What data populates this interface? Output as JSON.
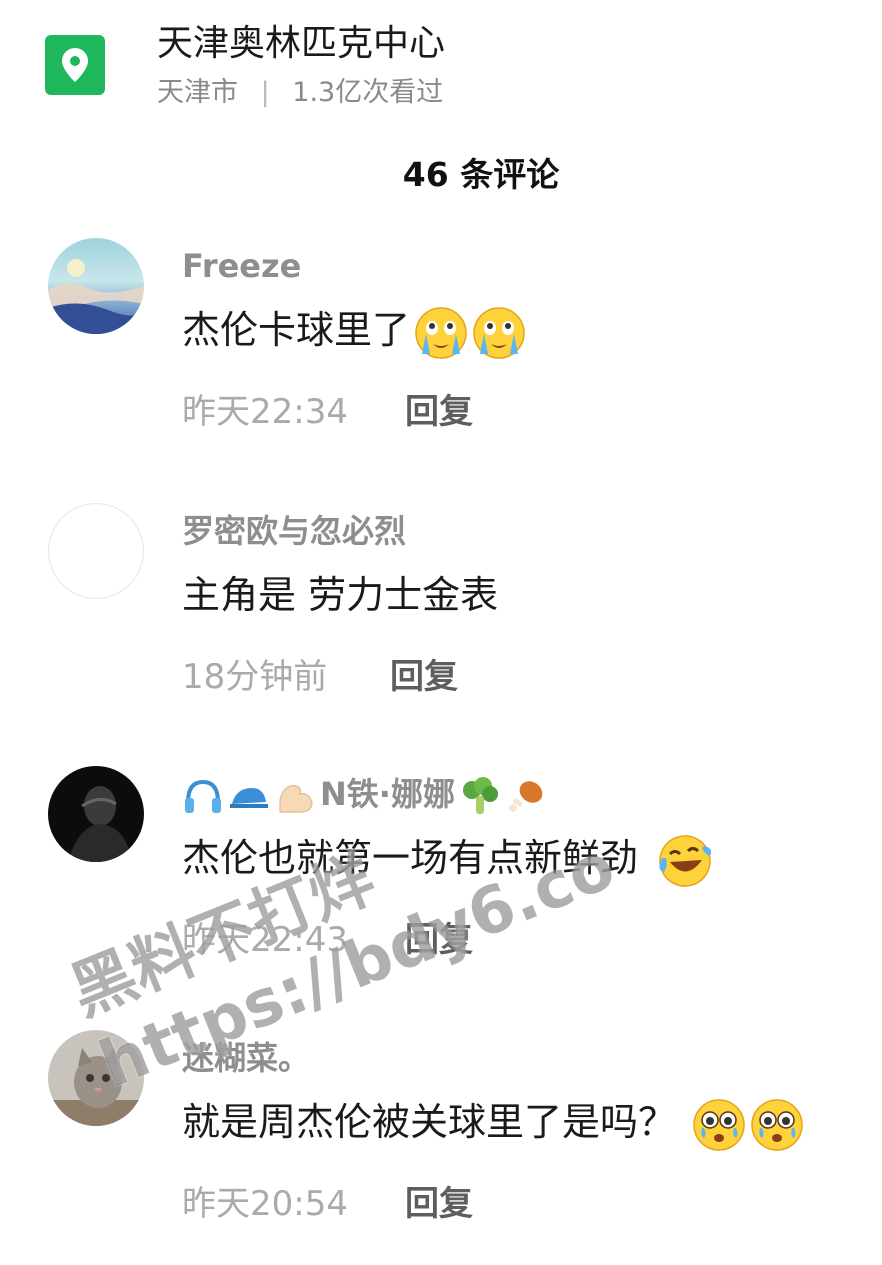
{
  "location": {
    "icon": "map-pin-icon",
    "title": "天津奥林匹克中心",
    "city": "天津市",
    "separator": "|",
    "views": "1.3亿次看过"
  },
  "comments_count": "46 条评论",
  "comments": [
    {
      "name": "Freeze",
      "text": "杰伦卡球里了",
      "emoji": [
        "crying-face-icon",
        "crying-face-icon"
      ],
      "time": "昨天22:34",
      "reply": "回复"
    },
    {
      "name": "罗密欧与忽必烈",
      "text": "主角是 劳力士金表",
      "emoji": [],
      "time": "18分钟前",
      "reply": "回复"
    },
    {
      "name_icons": [
        "headphones-icon",
        "cap-icon",
        "muscle-arm-icon"
      ],
      "name": "N铁·娜娜",
      "name_icons_after": [
        "broccoli-icon",
        "chicken-leg-icon"
      ],
      "text": "杰伦也就第一场有点新鲜劲",
      "emoji": [
        "laughing-tears-icon"
      ],
      "time": "昨天22:43",
      "reply": "回复"
    },
    {
      "name": "迷糊菜。",
      "text": "就是周杰伦被关球里了是吗？",
      "emoji": [
        "teary-shocked-icon",
        "teary-shocked-icon"
      ],
      "time": "昨天20:54",
      "reply": "回复"
    }
  ],
  "watermark": {
    "line1": "黑料不打烊",
    "line2": "https://bdy6.co"
  },
  "colors": {
    "pin_green": "#1fb75b",
    "name_gray": "#8e8e8e",
    "time_gray": "#aaaaaa"
  }
}
